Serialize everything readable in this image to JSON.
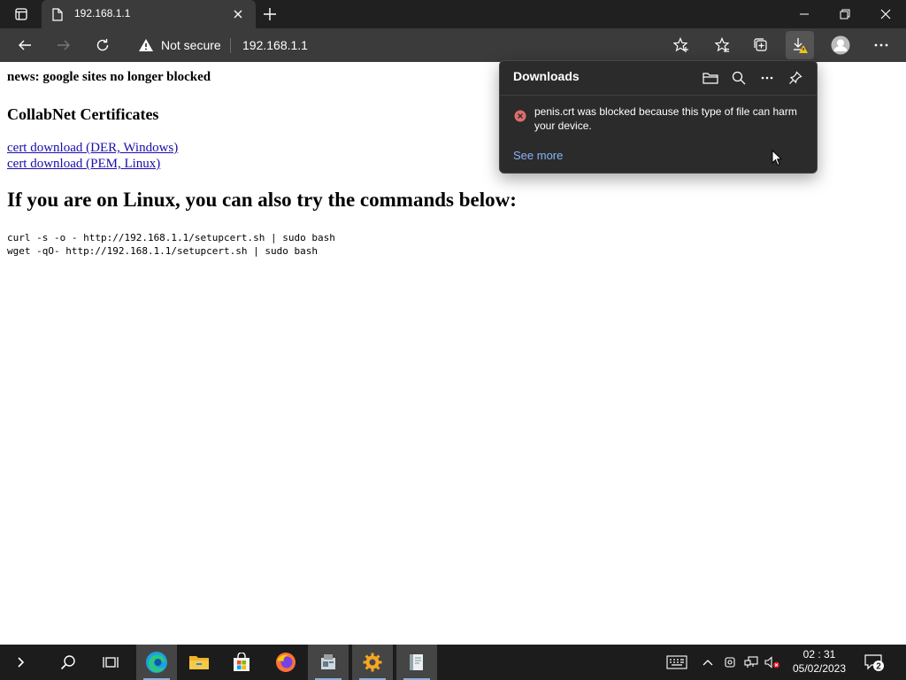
{
  "browser": {
    "tab": {
      "title": "192.168.1.1"
    },
    "address_bar": {
      "security_label": "Not secure",
      "url": "192.168.1.1"
    }
  },
  "page": {
    "news": "news: google sites no longer blocked",
    "certs_heading": "CollabNet Certificates",
    "links": [
      "cert download (DER, Windows)",
      "cert download (PEM, Linux)"
    ],
    "linux_heading": "If you are on Linux, you can also try the commands below:",
    "commands": [
      "curl -s -o - http://192.168.1.1/setupcert.sh | sudo bash",
      "wget -qO- http://192.168.1.1/setupcert.sh | sudo bash"
    ]
  },
  "downloads": {
    "title": "Downloads",
    "message": "penis.crt was blocked because this type of file can harm your device.",
    "see_more": "See more"
  },
  "taskbar": {
    "apps": [
      "edge-icon",
      "file-explorer-icon",
      "microsoft-store-icon",
      "firefox-icon",
      "app-icon",
      "settings-icon",
      "app-icon"
    ],
    "clock": {
      "time": "02 : 31",
      "date": "05/02/2023"
    },
    "notification_count": "2"
  },
  "colors": {
    "chrome_dark": "#202020",
    "toolbar": "#3b3b3b",
    "link": "#1a0dab",
    "error": "#e06c6c",
    "accent_link": "#8ab4f8"
  }
}
